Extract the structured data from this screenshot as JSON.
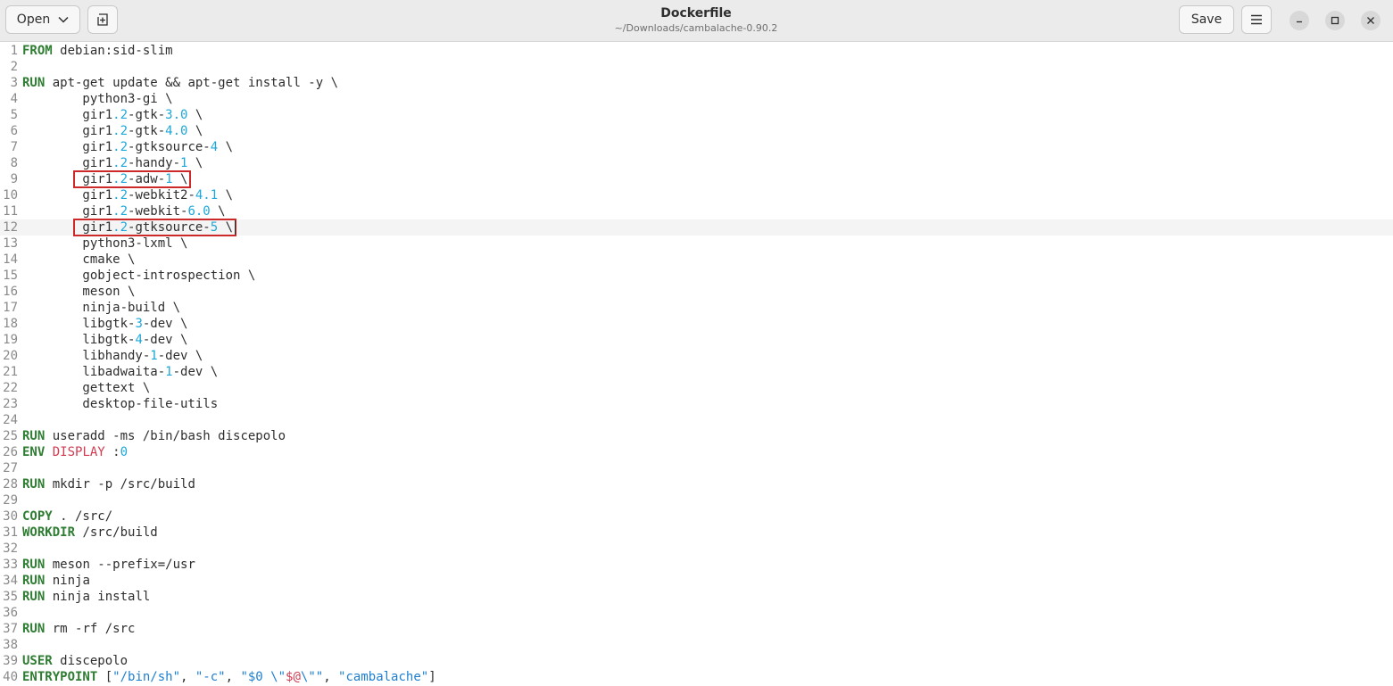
{
  "header": {
    "open_label": "Open",
    "save_label": "Save",
    "title": "Dockerfile",
    "subtitle": "~/Downloads/cambalache-0.90.2"
  },
  "icons": {
    "open": "chevron-down-icon",
    "new_tab": "new-tab-icon",
    "menu": "hamburger-menu-icon",
    "minimize": "minimize-icon",
    "maximize": "maximize-icon",
    "close": "close-icon"
  },
  "colors": {
    "keyword": "#2e7d32",
    "number": "#1ea7d8",
    "variable": "#d03b50",
    "string": "#1e7fd0",
    "highlight_box": "#cc2a2a"
  },
  "editor": {
    "current_line": 12,
    "highlighted_lines": [
      9,
      12
    ],
    "lines": [
      [
        [
          "kw",
          "FROM"
        ],
        [
          "t",
          " debian:sid-slim"
        ]
      ],
      [],
      [
        [
          "kw",
          "RUN"
        ],
        [
          "t",
          " apt-get update && apt-get install -y \\"
        ]
      ],
      [
        [
          "t",
          "        python3-gi \\"
        ]
      ],
      [
        [
          "t",
          "        gir1"
        ],
        [
          "num",
          ".2"
        ],
        [
          "t",
          "-gtk-"
        ],
        [
          "num",
          "3.0"
        ],
        [
          "t",
          " \\"
        ]
      ],
      [
        [
          "t",
          "        gir1"
        ],
        [
          "num",
          ".2"
        ],
        [
          "t",
          "-gtk-"
        ],
        [
          "num",
          "4.0"
        ],
        [
          "t",
          " \\"
        ]
      ],
      [
        [
          "t",
          "        gir1"
        ],
        [
          "num",
          ".2"
        ],
        [
          "t",
          "-gtksource-"
        ],
        [
          "num",
          "4"
        ],
        [
          "t",
          " \\"
        ]
      ],
      [
        [
          "t",
          "        gir1"
        ],
        [
          "num",
          ".2"
        ],
        [
          "t",
          "-handy-"
        ],
        [
          "num",
          "1"
        ],
        [
          "t",
          " \\"
        ]
      ],
      [
        [
          "t",
          "        gir1"
        ],
        [
          "num",
          ".2"
        ],
        [
          "t",
          "-adw-"
        ],
        [
          "num",
          "1"
        ],
        [
          "t",
          " \\"
        ]
      ],
      [
        [
          "t",
          "        gir1"
        ],
        [
          "num",
          ".2"
        ],
        [
          "t",
          "-webkit2-"
        ],
        [
          "num",
          "4.1"
        ],
        [
          "t",
          " \\"
        ]
      ],
      [
        [
          "t",
          "        gir1"
        ],
        [
          "num",
          ".2"
        ],
        [
          "t",
          "-webkit-"
        ],
        [
          "num",
          "6.0"
        ],
        [
          "t",
          " \\"
        ]
      ],
      [
        [
          "t",
          "        gir1"
        ],
        [
          "num",
          ".2"
        ],
        [
          "t",
          "-gtksource-"
        ],
        [
          "num",
          "5"
        ],
        [
          "t",
          " \\"
        ]
      ],
      [
        [
          "t",
          "        python3-lxml \\"
        ]
      ],
      [
        [
          "t",
          "        cmake \\"
        ]
      ],
      [
        [
          "t",
          "        gobject-introspection \\"
        ]
      ],
      [
        [
          "t",
          "        meson \\"
        ]
      ],
      [
        [
          "t",
          "        ninja-build \\"
        ]
      ],
      [
        [
          "t",
          "        libgtk-"
        ],
        [
          "num",
          "3"
        ],
        [
          "t",
          "-dev \\"
        ]
      ],
      [
        [
          "t",
          "        libgtk-"
        ],
        [
          "num",
          "4"
        ],
        [
          "t",
          "-dev \\"
        ]
      ],
      [
        [
          "t",
          "        libhandy-"
        ],
        [
          "num",
          "1"
        ],
        [
          "t",
          "-dev \\"
        ]
      ],
      [
        [
          "t",
          "        libadwaita-"
        ],
        [
          "num",
          "1"
        ],
        [
          "t",
          "-dev \\"
        ]
      ],
      [
        [
          "t",
          "        gettext \\"
        ]
      ],
      [
        [
          "t",
          "        desktop-file-utils"
        ]
      ],
      [],
      [
        [
          "kw",
          "RUN"
        ],
        [
          "t",
          " useradd -ms /bin/bash discepolo"
        ]
      ],
      [
        [
          "kw",
          "ENV"
        ],
        [
          "t",
          " "
        ],
        [
          "var",
          "DISPLAY"
        ],
        [
          "t",
          " :"
        ],
        [
          "num",
          "0"
        ]
      ],
      [],
      [
        [
          "kw",
          "RUN"
        ],
        [
          "t",
          " mkdir -p /src/build"
        ]
      ],
      [],
      [
        [
          "kw",
          "COPY"
        ],
        [
          "t",
          " . /src/"
        ]
      ],
      [
        [
          "kw",
          "WORKDIR"
        ],
        [
          "t",
          " /src/build"
        ]
      ],
      [],
      [
        [
          "kw",
          "RUN"
        ],
        [
          "t",
          " meson --prefix=/usr"
        ]
      ],
      [
        [
          "kw",
          "RUN"
        ],
        [
          "t",
          " ninja"
        ]
      ],
      [
        [
          "kw",
          "RUN"
        ],
        [
          "t",
          " ninja install"
        ]
      ],
      [],
      [
        [
          "kw",
          "RUN"
        ],
        [
          "t",
          " rm -rf /src"
        ]
      ],
      [],
      [
        [
          "kw",
          "USER"
        ],
        [
          "t",
          " discepolo"
        ]
      ],
      [
        [
          "kw",
          "ENTRYPOINT"
        ],
        [
          "t",
          " ["
        ],
        [
          "str",
          "\"/bin/sh\""
        ],
        [
          "t",
          ", "
        ],
        [
          "str",
          "\"-c\""
        ],
        [
          "t",
          ", "
        ],
        [
          "str",
          "\"$0 \\\""
        ],
        [
          "esc",
          "$@"
        ],
        [
          "str",
          "\\\"\""
        ],
        [
          "t",
          ", "
        ],
        [
          "str",
          "\"cambalache\""
        ],
        [
          "t",
          "]"
        ]
      ]
    ]
  }
}
